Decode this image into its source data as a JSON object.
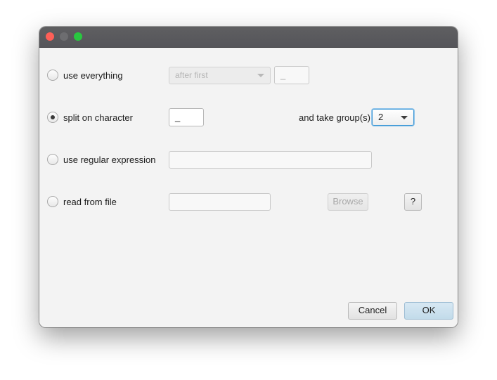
{
  "window": {
    "controls": [
      "close",
      "minimize",
      "maximize"
    ]
  },
  "options": {
    "use_everything": {
      "label": "use everything",
      "checked": false,
      "combo_value": "after first",
      "text_value": "_"
    },
    "split_on_character": {
      "label": "split on character",
      "checked": true,
      "text_value": "_",
      "group_label": "and take group(s):",
      "group_value": "2"
    },
    "use_regular_expression": {
      "label": "use regular expression",
      "checked": false,
      "text_value": ""
    },
    "read_from_file": {
      "label": "read from file",
      "checked": false,
      "text_value": "",
      "browse_label": "Browse",
      "help_label": "?"
    }
  },
  "footer": {
    "cancel_label": "Cancel",
    "ok_label": "OK"
  }
}
